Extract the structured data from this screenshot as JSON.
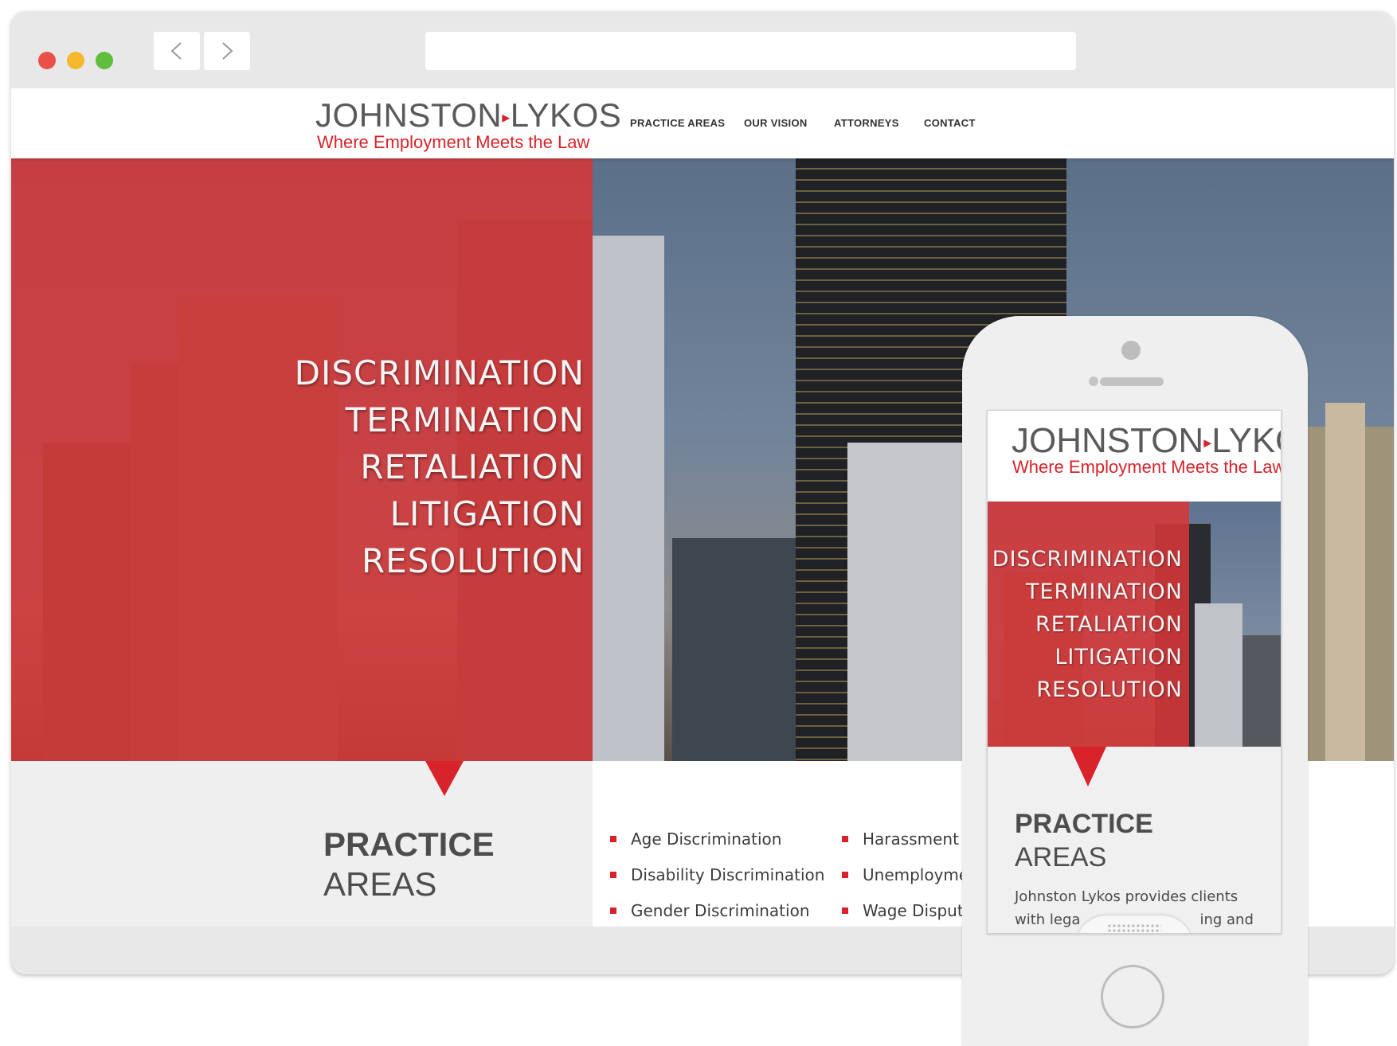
{
  "site": {
    "logo_name": "JOHNSTON",
    "logo_name2": "LYKOS",
    "logo_arrow": "▸",
    "logo_tagline": "Where Employment Meets the Law",
    "menu": [
      "PRACTICE AREAS",
      "OUR VISION",
      "ATTORNEYS",
      "CONTACT"
    ]
  },
  "hero": {
    "words": [
      "DISCRIMINATION",
      "TERMINATION",
      "RETALIATION",
      "LITIGATION",
      "RESOLUTION"
    ]
  },
  "practice": {
    "title": "PRACTICE",
    "subtitle": "AREAS",
    "items": [
      "Age Discrimination",
      "Disability Discrimination",
      "Gender Discrimination",
      "Harassment",
      "Unemployme",
      "Wage Dispute"
    ]
  },
  "mobile": {
    "logo_name": "JOHNSTON",
    "logo_name2": "LYKOS",
    "logo_arrow": "▸",
    "logo_tagline": "Where Employment Meets the Law",
    "words": [
      "DISCRIMINATION",
      "TERMINATION",
      "RETALIATION",
      "LITIGATION",
      "RESOLUTION"
    ],
    "title": "PRACTICE",
    "subtitle": "AREAS",
    "text_line1": "Johnston Lykos provides clients",
    "text_line2": "with lega",
    "text_line2_end": "ing and"
  },
  "colors": {
    "brand_red": "#d8232a",
    "hero_overlay": "#d63737",
    "logo_gray": "#5a5a5a",
    "browser_chrome": "#e8e8e9"
  },
  "icons": [
    "back-arrow-icon",
    "forward-arrow-icon",
    "camera-icon",
    "speaker-icon",
    "home-button-icon",
    "bullet-square-icon"
  ]
}
